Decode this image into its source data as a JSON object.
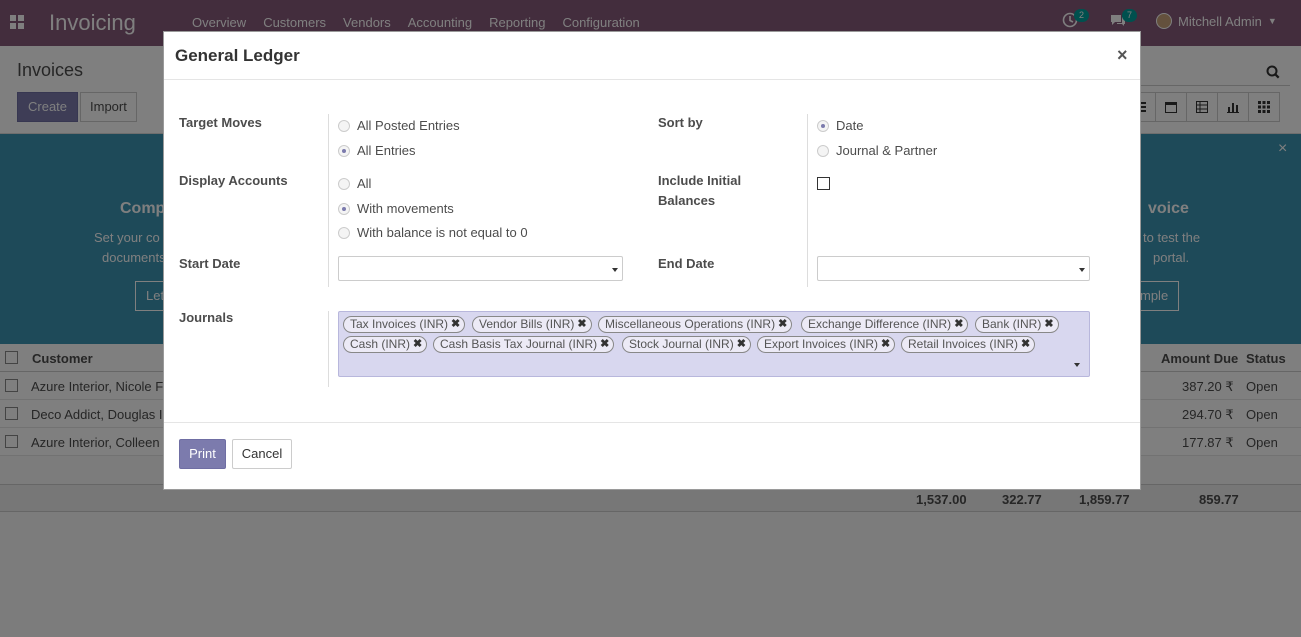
{
  "app": {
    "title": "Invoicing",
    "menu": [
      "Overview",
      "Customers",
      "Vendors",
      "Accounting",
      "Reporting",
      "Configuration"
    ],
    "activity_count": "2",
    "messages_count": "7",
    "user_name": "Mitchell Admin"
  },
  "control_panel": {
    "title": "Invoices",
    "create_label": "Create",
    "import_label": "Import"
  },
  "banner": {
    "left_title": "Comp",
    "left_text_1": "Set your co",
    "left_text_2": "documents",
    "left_button": "Let",
    "right_title": "voice",
    "right_text_1": "to test the",
    "right_text_2": "portal.",
    "right_button": "mple"
  },
  "list": {
    "headers": {
      "customer": "Customer",
      "amount_due": "Amount Due",
      "status": "Status"
    },
    "rows": [
      {
        "customer": "Azure Interior, Nicole F",
        "amount_due": "387.20 ₹",
        "status": "Open"
      },
      {
        "customer": "Deco Addict, Douglas I",
        "amount_due": "294.70 ₹",
        "status": "Open"
      },
      {
        "customer": "Azure Interior, Colleen",
        "amount_due": "177.87 ₹",
        "status": "Open"
      }
    ],
    "totals": [
      "1,537.00",
      "322.77",
      "1,859.77",
      "859.77"
    ]
  },
  "dialog": {
    "title": "General Ledger",
    "target_moves": {
      "label": "Target Moves",
      "options": [
        "All Posted Entries",
        "All Entries"
      ],
      "selected": 1
    },
    "sort_by": {
      "label": "Sort by",
      "options": [
        "Date",
        "Journal & Partner"
      ],
      "selected": 0
    },
    "display_accounts": {
      "label": "Display Accounts",
      "options": [
        "All",
        "With movements",
        "With balance is not equal to 0"
      ],
      "selected": 1
    },
    "include_initial_balances": {
      "label_line1": "Include Initial",
      "label_line2": "Balances",
      "checked": false
    },
    "start_date": {
      "label": "Start Date",
      "value": ""
    },
    "end_date": {
      "label": "End Date",
      "value": ""
    },
    "journals": {
      "label": "Journals",
      "tags": [
        "Tax Invoices (INR)",
        "Vendor Bills (INR)",
        "Miscellaneous Operations (INR)",
        "Exchange Difference (INR)",
        "Bank (INR)",
        "Cash (INR)",
        "Cash Basis Tax Journal (INR)",
        "Stock Journal (INR)",
        "Export Invoices (INR)",
        "Retail Invoices (INR)"
      ]
    },
    "print_label": "Print",
    "cancel_label": "Cancel"
  }
}
